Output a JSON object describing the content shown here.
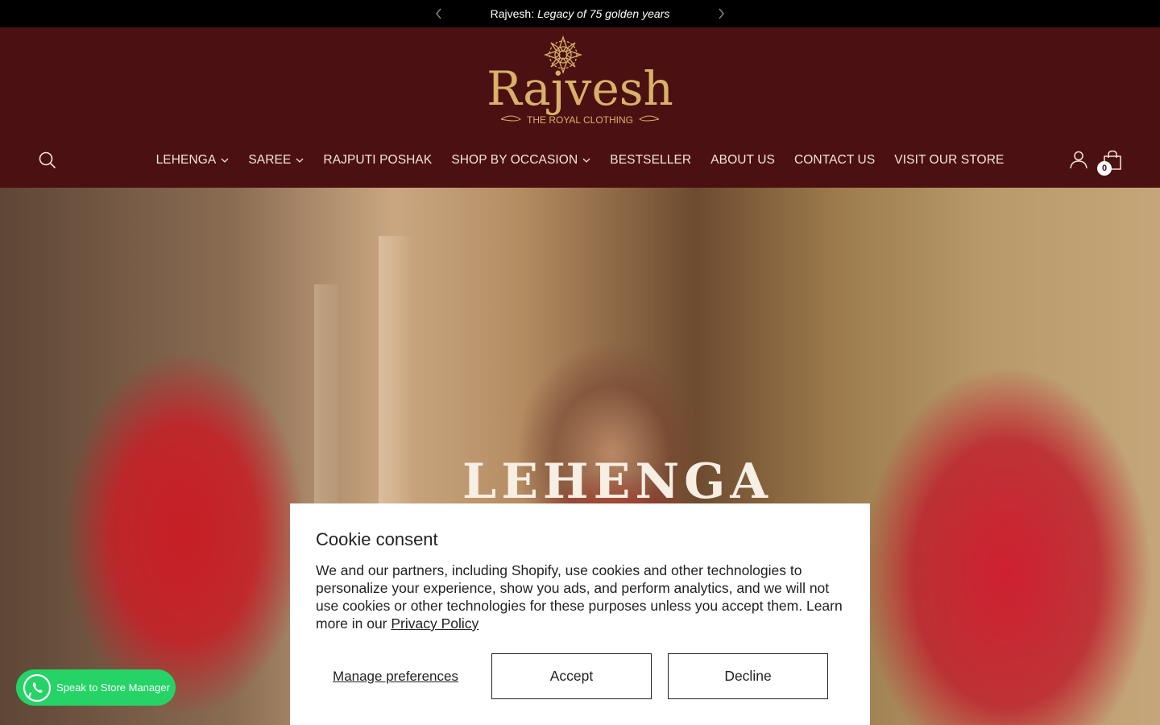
{
  "announcement": {
    "brand": "Rajvesh:",
    "tagline": "Legacy of 75 golden years"
  },
  "logo": {
    "wordmark": "Rajvesh",
    "subtitle": "THE ROYAL CLOTHING"
  },
  "nav": {
    "items": [
      {
        "label": "LEHENGA",
        "has_dropdown": true
      },
      {
        "label": "SAREE",
        "has_dropdown": true
      },
      {
        "label": "RAJPUTI POSHAK",
        "has_dropdown": false
      },
      {
        "label": "SHOP BY OCCASION",
        "has_dropdown": true
      },
      {
        "label": "BESTSELLER",
        "has_dropdown": false
      },
      {
        "label": "ABOUT US",
        "has_dropdown": false
      },
      {
        "label": "CONTACT US",
        "has_dropdown": false
      },
      {
        "label": "VISIT OUR STORE",
        "has_dropdown": false
      }
    ]
  },
  "cart": {
    "count": "0"
  },
  "hero": {
    "title": "LEHENGA"
  },
  "cookie": {
    "title": "Cookie consent",
    "body": "We and our partners, including Shopify, use cookies and other technologies to personalize your experience, show you ads, and perform analytics, and we will not use cookies or other technologies for these purposes unless you accept them. Learn more in our ",
    "link": "Privacy Policy",
    "manage": "Manage preferences",
    "accept": "Accept",
    "decline": "Decline"
  },
  "whatsapp": {
    "label": "Speak to Store Manager"
  },
  "colors": {
    "header_bg": "#4b1011",
    "announce_bg": "#000000",
    "gold": "#d8b16a",
    "whatsapp": "#25d366"
  }
}
